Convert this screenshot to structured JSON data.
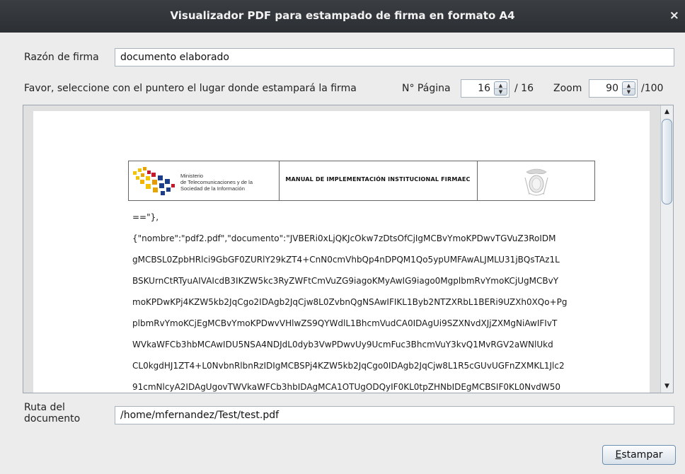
{
  "window": {
    "title": "Visualizador PDF para estampado de firma en formato A4",
    "close_label": "×"
  },
  "reason": {
    "label": "Razón de firma",
    "value": "documento elaborado"
  },
  "instructions": "Favor, seleccione con el puntero el lugar donde estampará la firma",
  "page_nav": {
    "label": "N° Página",
    "value": "16",
    "total": "/ 16"
  },
  "zoom": {
    "label": "Zoom",
    "value": "90",
    "max": "/100"
  },
  "document": {
    "header": {
      "ministry_lines": [
        "Ministerio",
        "de Telecomunicaciones y de la",
        "Sociedad de la Información"
      ],
      "manual_title": "MANUAL DE IMPLEMENTACIÓN INSTITUCIONAL FIRMAEC"
    },
    "lines": [
      "==\"},",
      "{\"nombre\":\"pdf2.pdf\",\"documento\":\"JVBERi0xLjQKJcOkw7zDtsOfCjIgMCBvYmoKPDwvTGVuZ3RoIDM",
      "gMCBSL0ZpbHRlci9GbGF0ZURlY29kZT4+CnN0cmVhbQp4nDPQM1Qo5ypUMFAwALJMLU31jBQsTAz1L",
      "BSKUrnCtRTyuAIVAIcdB3IKZW5kc3RyZWFtCmVuZG9iagoKMyAwIG9iago0MgplbmRvYmoKCjUgMCBvY",
      "moKPDwKPj4KZW5kb2JqCgo2IDAgb2JqCjw8L0ZvbnQgNSAwIFIKL1Byb2NTZXRbL1BERi9UZXh0XQo+Pg",
      "plbmRvYmoKCjEgMCBvYmoKPDwvVHlwZS9QYWdlL1BhcmVudCA0IDAgUi9SZXNvdXJjZXMgNiAwIFIvT",
      "WVkaWFCb3hbMCAwIDU5NSA4NDJdL0dyb3VwPDwvUy9UcmFuc3BhcmVuY3kvQ1MvRGV2aWNlUkd",
      "CL0kgdHJ1ZT4+L0NvbnRlbnRzIDIgMCBSPj4KZW5kb2JqCgo0IDAgb2JqCjw8L1R5cGUvUGFnZXMKL1Jlc2",
      "91cmNlcyA2IDAgUgovTWVkaWFCb3hbIDAgMCA1OTUgODQyIF0KL0tpZHNbIDEgMCBSIF0KL0NvdW50"
    ]
  },
  "path": {
    "label_line1": "Ruta del",
    "label_line2": "documento",
    "value": "/home/mfernandez/Test/test.pdf"
  },
  "action": {
    "mnemonic": "E",
    "rest": "stampar"
  }
}
